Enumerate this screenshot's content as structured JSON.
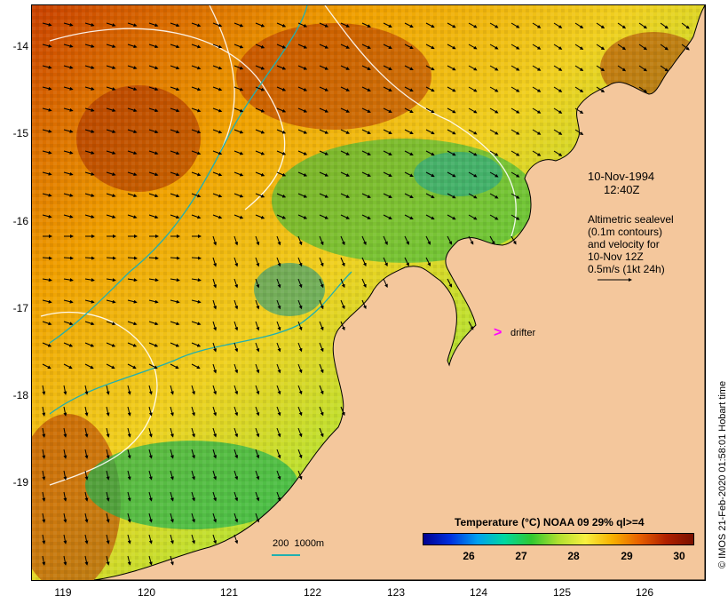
{
  "date_text": "10-Nov-1994",
  "time_text": "12:40Z",
  "legend_lines": [
    "Altimetric sealevel",
    "(0.1m contours)",
    "and velocity for",
    "10-Nov 12Z",
    "0.5m/s (1kt 24h)"
  ],
  "drifter_label": "drifter",
  "scale_label": "200  1000m",
  "colorbar": {
    "title": "Temperature (°C) NOAA 09 29% ql>=4",
    "ticks": [
      "26",
      "27",
      "28",
      "29",
      "30"
    ]
  },
  "credit": "© IMOS 21-Feb-2020 01:58:01 Hobart time",
  "axes": {
    "lat_labels": [
      "-14",
      "-15",
      "-16",
      "-17",
      "-18",
      "-19"
    ],
    "lon_labels": [
      "119",
      "120",
      "121",
      "122",
      "123",
      "124",
      "125",
      "126"
    ]
  },
  "colors": {
    "land": "#f4c79c",
    "drifter": "#ff00ff",
    "bathymetry_200m": "#20b0b0",
    "sealevel_contour": "#ffffff"
  }
}
